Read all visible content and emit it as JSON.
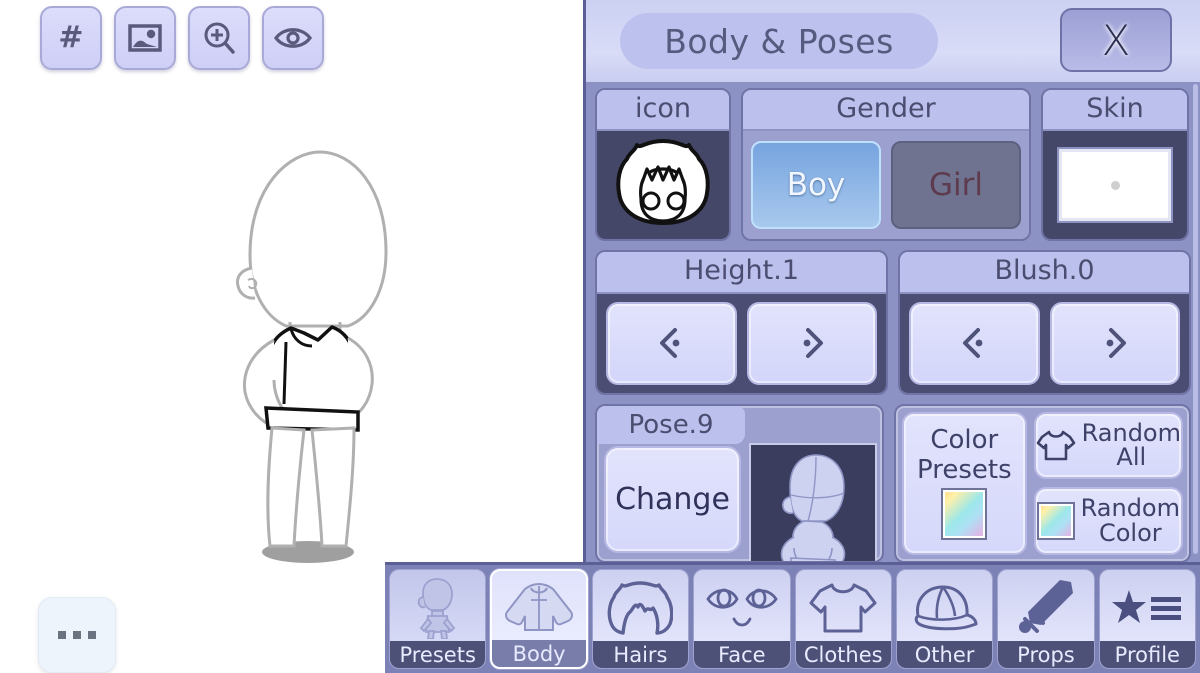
{
  "toolbar": {
    "buttons": [
      {
        "name": "hash-icon",
        "glyph": "#"
      },
      {
        "name": "image-icon",
        "glyph": ""
      },
      {
        "name": "zoom-in-icon",
        "glyph": ""
      },
      {
        "name": "eye-icon",
        "glyph": ""
      }
    ]
  },
  "overflow_button": {
    "label": "...",
    "name": "more-options-button"
  },
  "panel": {
    "title": "Body & Poses",
    "close_label": "X",
    "icon_card": {
      "label": "icon"
    },
    "gender_card": {
      "label": "Gender",
      "options": [
        {
          "label": "Boy",
          "selected": true
        },
        {
          "label": "Girl",
          "selected": false
        }
      ]
    },
    "skin_card": {
      "label": "Skin",
      "swatch_color": "#ffffff"
    },
    "height_card": {
      "label": "Height.1",
      "prev": "<·",
      "next": "·>"
    },
    "blush_card": {
      "label": "Blush.0",
      "prev": "<·",
      "next": "·>"
    },
    "pose_card": {
      "label": "Pose.9",
      "change_label": "Change"
    },
    "color_card": {
      "presets_label_line1": "Color",
      "presets_label_line2": "Presets",
      "random_all_line1": "Random",
      "random_all_line2": "All",
      "random_color_line1": "Random",
      "random_color_line2": "Color"
    }
  },
  "bottom_nav": {
    "items": [
      {
        "label": "Presets",
        "icon": "body-figure-icon",
        "active": false
      },
      {
        "label": "Body",
        "icon": "shirt-jacket-icon",
        "active": true
      },
      {
        "label": "Hairs",
        "icon": "hair-icon",
        "active": false
      },
      {
        "label": "Face",
        "icon": "eyes-face-icon",
        "active": false
      },
      {
        "label": "Clothes",
        "icon": "tshirt-icon",
        "active": false
      },
      {
        "label": "Other",
        "icon": "cap-icon",
        "active": false
      },
      {
        "label": "Props",
        "icon": "sword-icon",
        "active": false
      },
      {
        "label": "Profile",
        "icon": "star-list-icon",
        "active": false
      }
    ]
  },
  "colors": {
    "panel_bg": "#8d92c4",
    "panel_header": "#d0d4f4",
    "card_label": "#bcc0ec",
    "card_body_dark": "#444768",
    "accent_boy": "#77a4de",
    "nav_bg": "#7c81b6"
  }
}
